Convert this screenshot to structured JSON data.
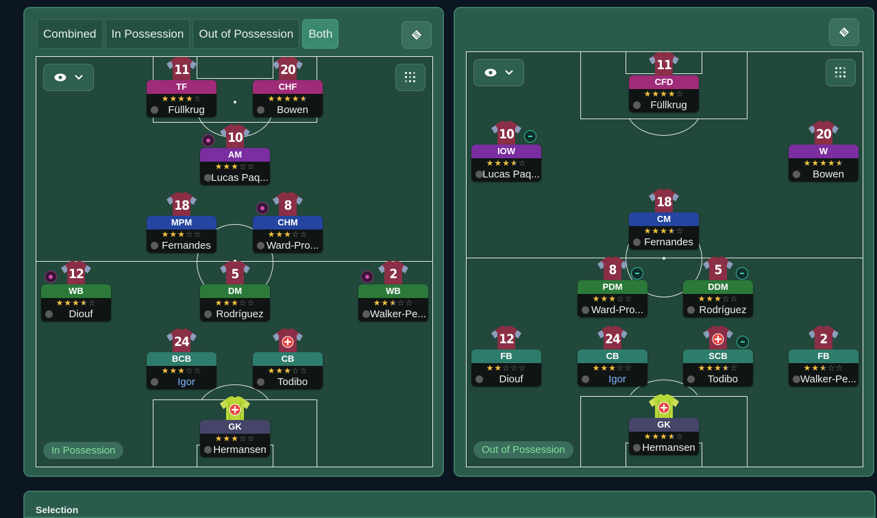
{
  "tabs": [
    {
      "label": "Combined",
      "active": false
    },
    {
      "label": "In Possession",
      "active": false
    },
    {
      "label": "Out of Possession",
      "active": false
    },
    {
      "label": "Both",
      "active": true
    }
  ],
  "left_pitch": {
    "phase_label": "In Possession",
    "players": [
      {
        "num": "11",
        "pos": "TF",
        "stars": 4,
        "name": "Füllkrug",
        "kit": "outfield"
      },
      {
        "num": "20",
        "pos": "CHF",
        "stars": 4.5,
        "name": "Bowen",
        "kit": "outfield"
      },
      {
        "num": "10",
        "pos": "AM",
        "stars": 3,
        "name": "Lucas Paq...",
        "kit": "outfield"
      },
      {
        "num": "18",
        "pos": "MPM",
        "stars": 3,
        "name": "Fernandes",
        "kit": "outfield"
      },
      {
        "num": "8",
        "pos": "CHM",
        "stars": 3,
        "name": "Ward-Pro...",
        "kit": "outfield"
      },
      {
        "num": "12",
        "pos": "WB",
        "stars": 3.5,
        "name": "Diouf",
        "kit": "outfield"
      },
      {
        "num": "5",
        "pos": "DM",
        "stars": 3,
        "name": "Rodríguez",
        "kit": "outfield"
      },
      {
        "num": "2",
        "pos": "WB",
        "stars": 2.5,
        "name": "Walker-Pe...",
        "kit": "outfield"
      },
      {
        "num": "24",
        "pos": "BCB",
        "stars": 3,
        "name": "Igor",
        "kit": "outfield",
        "name_color": "blue"
      },
      {
        "num": "",
        "pos": "CB",
        "stars": 3,
        "name": "Todibo",
        "kit": "outfield",
        "injured": true
      },
      {
        "num": "",
        "pos": "GK",
        "stars": 3,
        "name": "Hermansen",
        "kit": "keeper",
        "injured": true
      }
    ]
  },
  "right_pitch": {
    "phase_label": "Out of Possession",
    "players": [
      {
        "num": "11",
        "pos": "CFD",
        "stars": 4,
        "name": "Füllkrug",
        "kit": "outfield"
      },
      {
        "num": "10",
        "pos": "IOW",
        "stars": 3.5,
        "name": "Lucas Paq...",
        "kit": "outfield"
      },
      {
        "num": "20",
        "pos": "W",
        "stars": 4.5,
        "name": "Bowen",
        "kit": "outfield"
      },
      {
        "num": "18",
        "pos": "CM",
        "stars": 3.5,
        "name": "Fernandes",
        "kit": "outfield"
      },
      {
        "num": "8",
        "pos": "PDM",
        "stars": 3,
        "name": "Ward-Pro...",
        "kit": "outfield"
      },
      {
        "num": "5",
        "pos": "DDM",
        "stars": 3,
        "name": "Rodríguez",
        "kit": "outfield"
      },
      {
        "num": "12",
        "pos": "FB",
        "stars": 2,
        "name": "Diouf",
        "kit": "outfield"
      },
      {
        "num": "24",
        "pos": "CB",
        "stars": 3,
        "name": "Igor",
        "kit": "outfield",
        "name_color": "blue"
      },
      {
        "num": "",
        "pos": "SCB",
        "stars": 3.5,
        "name": "Todibo",
        "kit": "outfield",
        "injured": true
      },
      {
        "num": "2",
        "pos": "FB",
        "stars": 2.5,
        "name": "Walker-Pe...",
        "kit": "outfield"
      },
      {
        "num": "",
        "pos": "GK",
        "stars": 3.5,
        "name": "Hermansen",
        "kit": "keeper",
        "injured": true
      }
    ]
  },
  "colors": {
    "kit": "#8a2f45",
    "kit_sleeve": "#8ab0d0",
    "keeper_kit": "#b8d838",
    "star_gold": "#f0c040",
    "star_empty": "#8a8a8a",
    "panel_bg": "#2a5b4c"
  },
  "icons": {
    "view_toggle": "eye-icon",
    "expand": "chevron-down-icon",
    "grid": "grid-icon",
    "pitch_settings": "pitch-icon",
    "injury": "injury-cross-icon"
  },
  "bottom_panel": {
    "title": "Selection"
  }
}
